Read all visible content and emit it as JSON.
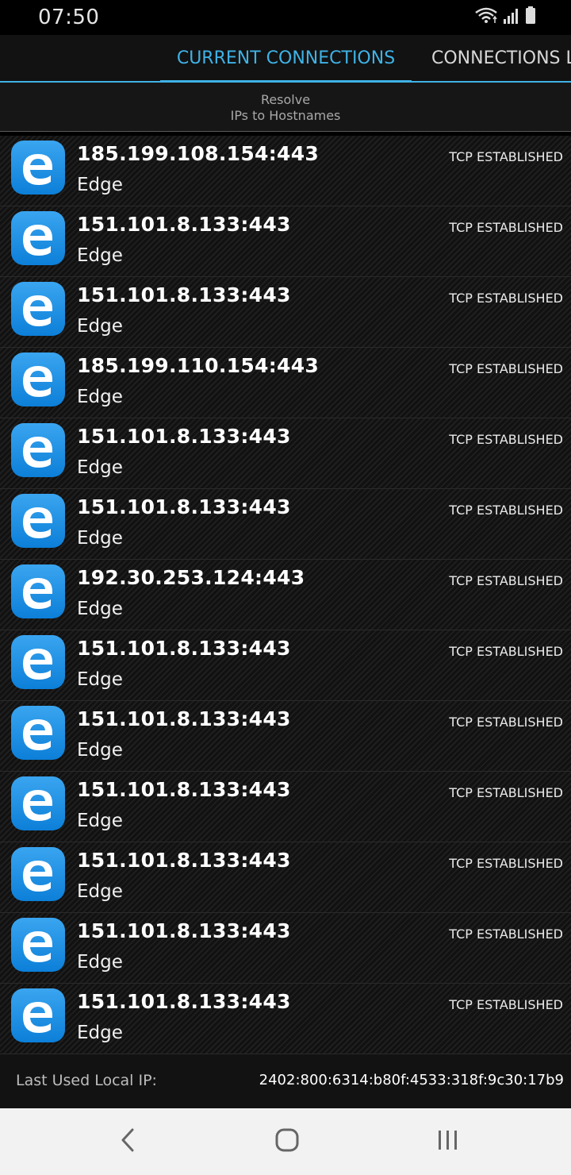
{
  "status_bar": {
    "time": "07:50",
    "icons": [
      "wifi-icon",
      "signal-icon",
      "battery-icon"
    ]
  },
  "tabs": [
    {
      "label": "CURRENT CONNECTIONS",
      "active": true
    },
    {
      "label": "CONNECTIONS L",
      "active": false
    }
  ],
  "resolve": {
    "line1": "Resolve",
    "line2": "IPs to Hostnames"
  },
  "connections": [
    {
      "address": "185.199.108.154:443",
      "app": "Edge",
      "state": "TCP ESTABLISHED"
    },
    {
      "address": "151.101.8.133:443",
      "app": "Edge",
      "state": "TCP ESTABLISHED"
    },
    {
      "address": "151.101.8.133:443",
      "app": "Edge",
      "state": "TCP ESTABLISHED"
    },
    {
      "address": "185.199.110.154:443",
      "app": "Edge",
      "state": "TCP ESTABLISHED"
    },
    {
      "address": "151.101.8.133:443",
      "app": "Edge",
      "state": "TCP ESTABLISHED"
    },
    {
      "address": "151.101.8.133:443",
      "app": "Edge",
      "state": "TCP ESTABLISHED"
    },
    {
      "address": "192.30.253.124:443",
      "app": "Edge",
      "state": "TCP ESTABLISHED"
    },
    {
      "address": "151.101.8.133:443",
      "app": "Edge",
      "state": "TCP ESTABLISHED"
    },
    {
      "address": "151.101.8.133:443",
      "app": "Edge",
      "state": "TCP ESTABLISHED"
    },
    {
      "address": "151.101.8.133:443",
      "app": "Edge",
      "state": "TCP ESTABLISHED"
    },
    {
      "address": "151.101.8.133:443",
      "app": "Edge",
      "state": "TCP ESTABLISHED"
    },
    {
      "address": "151.101.8.133:443",
      "app": "Edge",
      "state": "TCP ESTABLISHED"
    },
    {
      "address": "151.101.8.133:443",
      "app": "Edge",
      "state": "TCP ESTABLISHED"
    }
  ],
  "footer": {
    "label": "Last Used Local IP:",
    "value": "2402:800:6314:b80f:4533:318f:9c30:17b9"
  },
  "colors": {
    "accent": "#3fb2e6",
    "edge_blue": "#0c7fd8"
  },
  "nav": [
    "back-icon",
    "home-icon",
    "recents-icon"
  ]
}
